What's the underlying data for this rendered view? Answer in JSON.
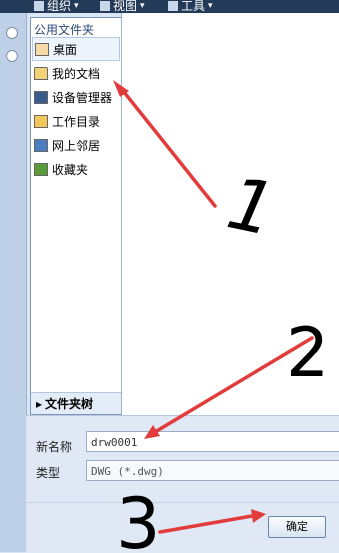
{
  "toolbar": {
    "organize": "组织",
    "view": "视图",
    "tools": "工具",
    "caret": "▾"
  },
  "nav": {
    "header": "公用文件夹",
    "items": [
      {
        "label": "桌面",
        "icon": "desktop-icon",
        "selected": true
      },
      {
        "label": "我的文档",
        "icon": "my-documents-icon"
      },
      {
        "label": "设备管理器",
        "icon": "device-manager-icon"
      },
      {
        "label": "工作目录",
        "icon": "work-folder-icon"
      },
      {
        "label": "网上邻居",
        "icon": "network-icon"
      },
      {
        "label": "收藏夹",
        "icon": "favorites-icon"
      }
    ],
    "folder_tree": "文件夹树",
    "folder_tree_arrow": "▸"
  },
  "form": {
    "name_label": "新名称",
    "name_value": "drw0001",
    "type_label": "类型",
    "type_value": "DWG (*.dwg)",
    "ok": "确定"
  },
  "annotations": {
    "n1": "1",
    "n2": "2",
    "n3": "3",
    "arrow_color": "#e23b3b",
    "ink_color": "#000000"
  }
}
